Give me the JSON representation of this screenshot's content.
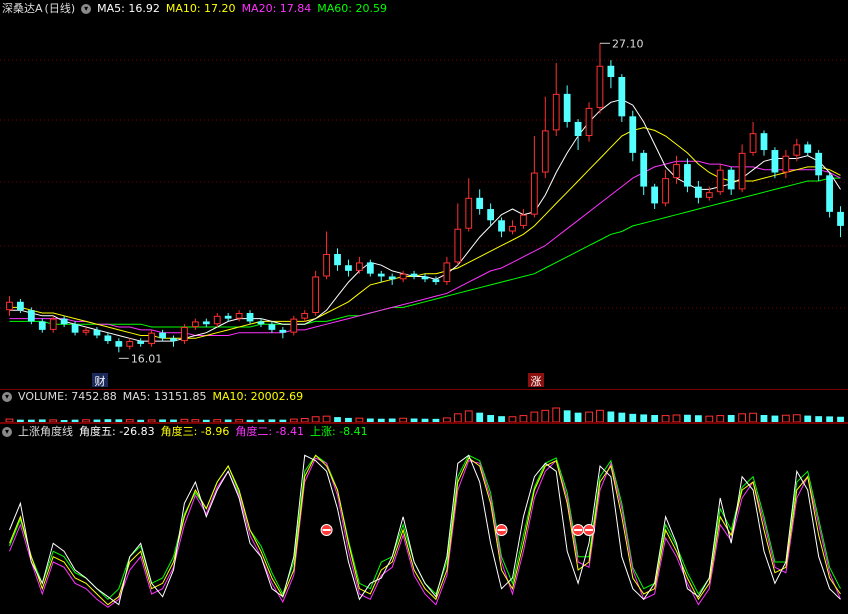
{
  "main": {
    "title": "深桑达A",
    "period": "(日线)",
    "ma": [
      {
        "label": "MA5: 16.92",
        "color": "#ffffff"
      },
      {
        "label": "MA10: 17.20",
        "color": "#ffff00"
      },
      {
        "label": "MA20: 17.84",
        "color": "#ff33ff"
      },
      {
        "label": "MA60: 20.59",
        "color": "#00ff00"
      }
    ],
    "high_label": "27.10",
    "low_label": "16.01",
    "event_cai": "财",
    "event_zhang": "涨"
  },
  "volume": {
    "title": "VOLUME: 7452.88",
    "ma5": "MA5: 13151.85",
    "ma10": "MA10: 20002.69"
  },
  "indicator": {
    "title": "上涨角度线",
    "lines": [
      {
        "label": "角度五: -26.83",
        "color": "#ffffff"
      },
      {
        "label": "角度三: -8.96",
        "color": "#ffff00"
      },
      {
        "label": "角度二: -8.41",
        "color": "#ff33ff"
      },
      {
        "label": "上涨: -8.41",
        "color": "#00ff00"
      }
    ]
  },
  "colors": {
    "up": "#ff3030",
    "down": "#54ffff",
    "ma5": "#ffffff",
    "ma10": "#ffff00",
    "ma20": "#ff33ff",
    "ma60": "#00ff00"
  },
  "chart_data": {
    "type": "candlestick",
    "price_range": [
      15.4,
      28.0
    ],
    "closes": [
      17.9,
      17.6,
      17.2,
      16.9,
      17.3,
      17.1,
      16.8,
      16.9,
      16.7,
      16.5,
      16.3,
      16.5,
      16.4,
      16.8,
      16.6,
      16.5,
      17.0,
      17.2,
      17.1,
      17.4,
      17.3,
      17.5,
      17.2,
      17.1,
      16.9,
      16.8,
      17.3,
      17.5,
      18.8,
      19.6,
      19.2,
      19.0,
      19.3,
      18.9,
      18.8,
      18.7,
      18.9,
      18.8,
      18.7,
      18.6,
      19.3,
      20.5,
      21.6,
      21.2,
      20.8,
      20.4,
      20.6,
      21.0,
      22.5,
      24.0,
      25.3,
      24.3,
      23.8,
      24.8,
      26.3,
      25.9,
      24.5,
      23.2,
      22.0,
      21.4,
      22.3,
      22.8,
      22.0,
      21.6,
      21.8,
      22.6,
      21.9,
      23.2,
      23.9,
      23.3,
      22.5,
      23.1,
      23.5,
      23.2,
      22.4,
      21.1,
      20.6
    ],
    "opens": [
      17.6,
      17.9,
      17.6,
      17.2,
      16.9,
      17.3,
      17.1,
      16.8,
      16.9,
      16.7,
      16.5,
      16.3,
      16.5,
      16.4,
      16.8,
      16.6,
      16.5,
      17.0,
      17.2,
      17.1,
      17.4,
      17.3,
      17.5,
      17.2,
      17.1,
      16.9,
      16.8,
      17.3,
      17.5,
      18.8,
      19.6,
      19.2,
      19.0,
      19.3,
      18.9,
      18.8,
      18.7,
      18.9,
      18.8,
      18.7,
      18.6,
      19.3,
      20.5,
      21.6,
      21.2,
      20.8,
      20.4,
      20.6,
      21.0,
      22.5,
      24.0,
      25.3,
      24.3,
      23.8,
      24.8,
      26.3,
      25.9,
      24.5,
      23.2,
      22.0,
      21.4,
      22.3,
      22.8,
      22.0,
      21.6,
      21.8,
      22.6,
      21.9,
      23.2,
      23.9,
      23.3,
      22.5,
      23.1,
      23.5,
      23.2,
      22.4,
      21.1
    ],
    "highs": [
      18.1,
      18.0,
      17.7,
      17.3,
      17.4,
      17.4,
      17.2,
      17.0,
      17.0,
      16.8,
      16.6,
      16.6,
      16.6,
      16.9,
      16.9,
      16.7,
      17.1,
      17.3,
      17.3,
      17.5,
      17.5,
      17.6,
      17.6,
      17.3,
      17.2,
      17.0,
      17.4,
      17.6,
      19.0,
      20.4,
      19.8,
      19.4,
      19.5,
      19.4,
      19.0,
      18.9,
      19.0,
      19.0,
      18.9,
      18.8,
      19.5,
      21.4,
      22.3,
      21.9,
      21.4,
      20.9,
      20.8,
      21.2,
      23.8,
      25.2,
      26.4,
      25.6,
      24.4,
      25.0,
      27.1,
      26.5,
      26.0,
      24.7,
      23.3,
      22.1,
      22.6,
      23.1,
      23.0,
      22.2,
      22.0,
      22.8,
      22.7,
      23.5,
      24.3,
      24.0,
      23.4,
      23.3,
      23.7,
      23.6,
      23.3,
      22.5,
      21.3
    ],
    "lows": [
      17.4,
      17.5,
      17.1,
      16.8,
      16.8,
      17.0,
      16.7,
      16.7,
      16.6,
      16.4,
      16.1,
      16.2,
      16.3,
      16.3,
      16.5,
      16.3,
      16.4,
      16.9,
      17.0,
      17.0,
      17.2,
      17.2,
      17.1,
      17.0,
      16.8,
      16.6,
      16.7,
      17.2,
      17.4,
      18.7,
      19.0,
      18.8,
      18.9,
      18.8,
      18.6,
      18.5,
      18.6,
      18.7,
      18.6,
      18.5,
      18.5,
      19.2,
      20.4,
      21.0,
      20.6,
      20.2,
      20.3,
      20.5,
      20.9,
      22.3,
      23.8,
      24.1,
      23.3,
      23.6,
      24.6,
      25.5,
      24.3,
      22.9,
      21.7,
      21.2,
      21.3,
      22.1,
      21.8,
      21.4,
      21.5,
      21.7,
      21.7,
      21.8,
      23.1,
      23.1,
      22.3,
      22.3,
      22.9,
      23.1,
      22.2,
      20.9,
      20.2
    ],
    "ma5": [
      17.6,
      17.6,
      17.5,
      17.4,
      17.4,
      17.2,
      17.1,
      17.0,
      16.9,
      16.8,
      16.7,
      16.6,
      16.5,
      16.5,
      16.5,
      16.5,
      16.6,
      16.7,
      16.8,
      17.0,
      17.2,
      17.3,
      17.3,
      17.3,
      17.2,
      17.1,
      17.1,
      17.1,
      17.3,
      17.6,
      18.1,
      18.6,
      19.0,
      19.3,
      19.2,
      19.0,
      18.9,
      18.8,
      18.8,
      18.7,
      18.9,
      19.2,
      19.7,
      20.2,
      20.6,
      21.0,
      21.2,
      21.0,
      21.1,
      21.7,
      22.5,
      23.2,
      23.8,
      24.3,
      24.7,
      25.0,
      25.1,
      24.9,
      24.3,
      23.5,
      22.7,
      22.3,
      22.1,
      21.9,
      21.9,
      22.0,
      22.1,
      22.3,
      22.6,
      22.9,
      23.0,
      23.0,
      23.0,
      23.1,
      22.9,
      22.5,
      21.9
    ],
    "ma10": [
      17.7,
      17.7,
      17.6,
      17.5,
      17.5,
      17.4,
      17.3,
      17.2,
      17.1,
      17.0,
      16.9,
      16.8,
      16.7,
      16.7,
      16.6,
      16.6,
      16.6,
      16.6,
      16.7,
      16.8,
      16.9,
      17.0,
      17.1,
      17.2,
      17.2,
      17.2,
      17.2,
      17.2,
      17.3,
      17.5,
      17.7,
      17.9,
      18.2,
      18.5,
      18.6,
      18.7,
      18.8,
      18.8,
      18.9,
      18.9,
      19.0,
      19.1,
      19.3,
      19.5,
      19.7,
      19.9,
      20.1,
      20.3,
      20.6,
      21.0,
      21.4,
      21.8,
      22.2,
      22.6,
      23.0,
      23.4,
      23.8,
      24.0,
      24.1,
      24.0,
      23.8,
      23.5,
      23.2,
      22.8,
      22.5,
      22.3,
      22.2,
      22.2,
      22.2,
      22.3,
      22.4,
      22.5,
      22.6,
      22.7,
      22.7,
      22.6,
      22.4
    ],
    "ma20": [
      17.3,
      17.3,
      17.3,
      17.3,
      17.3,
      17.3,
      17.2,
      17.2,
      17.1,
      17.1,
      17.0,
      17.0,
      16.9,
      16.9,
      16.8,
      16.8,
      16.8,
      16.7,
      16.7,
      16.7,
      16.7,
      16.8,
      16.8,
      16.8,
      16.8,
      16.8,
      16.9,
      16.9,
      17.0,
      17.1,
      17.2,
      17.3,
      17.4,
      17.5,
      17.6,
      17.7,
      17.8,
      17.9,
      18.0,
      18.1,
      18.2,
      18.4,
      18.6,
      18.8,
      19.0,
      19.1,
      19.3,
      19.5,
      19.7,
      19.9,
      20.2,
      20.5,
      20.8,
      21.1,
      21.4,
      21.7,
      22.0,
      22.3,
      22.5,
      22.7,
      22.8,
      22.9,
      22.9,
      22.9,
      22.8,
      22.8,
      22.7,
      22.7,
      22.7,
      22.6,
      22.6,
      22.6,
      22.6,
      22.6,
      22.6,
      22.5,
      22.3
    ],
    "ma60": [
      17.2,
      17.2,
      17.2,
      17.2,
      17.1,
      17.1,
      17.1,
      17.1,
      17.1,
      17.1,
      17.1,
      17.1,
      17.1,
      17.0,
      17.0,
      17.0,
      17.0,
      17.0,
      17.0,
      17.0,
      17.0,
      17.0,
      17.0,
      17.1,
      17.1,
      17.1,
      17.1,
      17.1,
      17.2,
      17.2,
      17.3,
      17.4,
      17.4,
      17.5,
      17.6,
      17.7,
      17.7,
      17.8,
      17.9,
      18.0,
      18.1,
      18.2,
      18.3,
      18.4,
      18.5,
      18.6,
      18.7,
      18.8,
      18.9,
      19.1,
      19.3,
      19.5,
      19.7,
      19.9,
      20.1,
      20.3,
      20.4,
      20.6,
      20.7,
      20.8,
      20.9,
      21.0,
      21.1,
      21.2,
      21.3,
      21.4,
      21.5,
      21.6,
      21.7,
      21.8,
      21.9,
      22.0,
      22.1,
      22.2,
      22.2,
      22.3,
      22.3
    ],
    "volume": [
      0.25,
      0.2,
      0.2,
      0.22,
      0.18,
      0.17,
      0.2,
      0.19,
      0.21,
      0.24,
      0.23,
      0.2,
      0.19,
      0.18,
      0.22,
      0.21,
      0.23,
      0.2,
      0.19,
      0.2,
      0.21,
      0.2,
      0.19,
      0.2,
      0.22,
      0.2,
      0.25,
      0.3,
      0.45,
      0.5,
      0.42,
      0.35,
      0.33,
      0.3,
      0.28,
      0.3,
      0.32,
      0.3,
      0.28,
      0.27,
      0.35,
      0.7,
      0.95,
      0.8,
      0.6,
      0.5,
      0.45,
      0.55,
      0.85,
      1.0,
      1.2,
      1.0,
      0.8,
      0.85,
      1.0,
      0.9,
      0.8,
      0.7,
      0.65,
      0.6,
      0.55,
      0.6,
      0.62,
      0.58,
      0.5,
      0.55,
      0.6,
      0.7,
      0.75,
      0.6,
      0.55,
      0.58,
      0.62,
      0.55,
      0.5,
      0.48,
      0.45
    ],
    "angle_range": [
      -30,
      30
    ],
    "angle5": [
      0,
      10,
      -12,
      -20,
      -5,
      -8,
      -15,
      -18,
      -22,
      -25,
      -28,
      -10,
      -5,
      -20,
      -25,
      -15,
      10,
      18,
      5,
      15,
      22,
      12,
      -5,
      -10,
      -22,
      -25,
      -10,
      28,
      26,
      22,
      8,
      -12,
      -26,
      -20,
      -18,
      -10,
      5,
      -12,
      -20,
      -25,
      -10,
      25,
      28,
      18,
      -5,
      -22,
      -18,
      5,
      20,
      25,
      22,
      -8,
      -20,
      -5,
      24,
      20,
      -10,
      -22,
      -26,
      -20,
      5,
      -5,
      -22,
      -25,
      -18,
      12,
      -5,
      20,
      15,
      -8,
      -20,
      -12,
      22,
      15,
      -10,
      -22,
      -26
    ],
    "angle3": [
      -5,
      5,
      -10,
      -22,
      -10,
      -12,
      -18,
      -20,
      -24,
      -28,
      -25,
      -12,
      -8,
      -22,
      -20,
      -12,
      5,
      15,
      8,
      18,
      24,
      15,
      0,
      -8,
      -18,
      -25,
      -15,
      20,
      28,
      24,
      15,
      -5,
      -22,
      -24,
      -15,
      -12,
      0,
      -15,
      -22,
      -26,
      -15,
      18,
      27,
      24,
      10,
      -15,
      -22,
      -5,
      15,
      24,
      26,
      10,
      -15,
      -12,
      18,
      24,
      5,
      -18,
      -24,
      -22,
      0,
      -8,
      -18,
      -26,
      -20,
      5,
      -2,
      15,
      18,
      0,
      -16,
      -14,
      15,
      20,
      -2,
      -18,
      -24
    ],
    "angle2": [
      -8,
      2,
      -12,
      -24,
      -12,
      -14,
      -20,
      -22,
      -26,
      -29,
      -26,
      -15,
      -10,
      -24,
      -22,
      -14,
      2,
      13,
      6,
      16,
      22,
      13,
      -2,
      -10,
      -20,
      -27,
      -17,
      18,
      27,
      25,
      13,
      -8,
      -24,
      -26,
      -17,
      -14,
      -2,
      -17,
      -24,
      -28,
      -17,
      15,
      26,
      25,
      12,
      -12,
      -24,
      -8,
      12,
      22,
      26,
      12,
      -12,
      -14,
      15,
      25,
      8,
      -15,
      -26,
      -24,
      -3,
      -10,
      -20,
      -28,
      -22,
      2,
      -4,
      12,
      18,
      3,
      -14,
      -16,
      12,
      20,
      2,
      -16,
      -26
    ],
    "rise": [
      -6,
      4,
      -10,
      -20,
      -8,
      -10,
      -16,
      -18,
      -22,
      -26,
      -22,
      -10,
      -6,
      -20,
      -18,
      -10,
      6,
      14,
      8,
      18,
      24,
      14,
      0,
      -6,
      -16,
      -24,
      -12,
      22,
      28,
      25,
      15,
      -4,
      -20,
      -22,
      -12,
      -10,
      2,
      -12,
      -20,
      -24,
      -12,
      20,
      28,
      26,
      14,
      -10,
      -20,
      -2,
      16,
      25,
      27,
      14,
      -10,
      -10,
      20,
      26,
      10,
      -14,
      -22,
      -20,
      2,
      -6,
      -16,
      -24,
      -18,
      8,
      0,
      16,
      20,
      5,
      -12,
      -12,
      18,
      22,
      4,
      -14,
      -22
    ],
    "markers": [
      29,
      45,
      52,
      53
    ]
  }
}
